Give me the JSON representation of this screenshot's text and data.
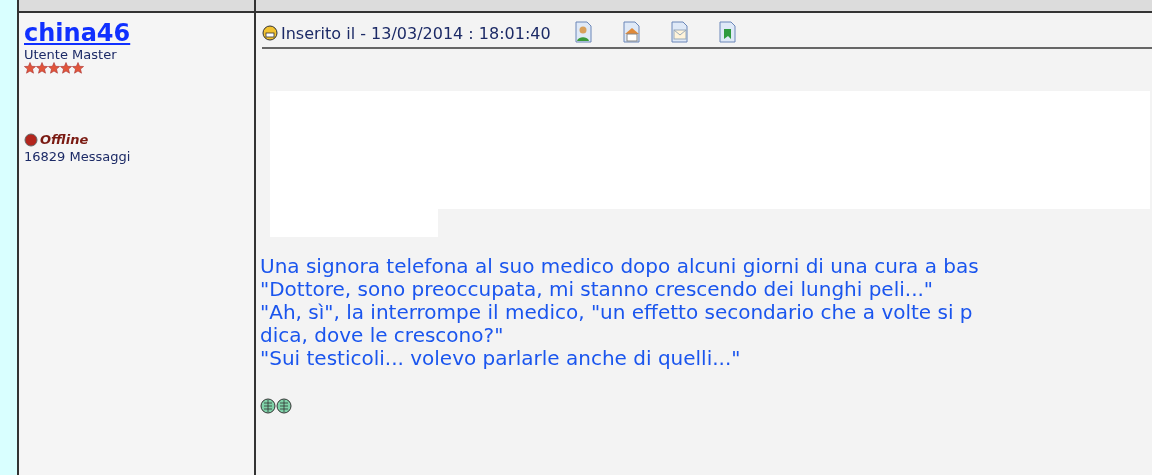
{
  "author": {
    "name": "china46",
    "rank": "Utente Master",
    "stars": 5,
    "status": "Offline",
    "posts": "16829 Messaggi"
  },
  "post": {
    "date": "Inserito il - 13/03/2014 : 18:01:40",
    "lines": [
      "Una signora telefona al suo medico dopo alcuni giorni di una cura a bas",
      "\"Dottore, sono preoccupata, mi stanno crescendo dei lunghi peli...\"",
      "\"Ah, sì\", la interrompe il medico, \"un effetto secondario che a volte si p",
      "dica, dove le crescono?\"",
      "\"Sui testicoli... volevo parlarle anche di quelli...\""
    ]
  }
}
